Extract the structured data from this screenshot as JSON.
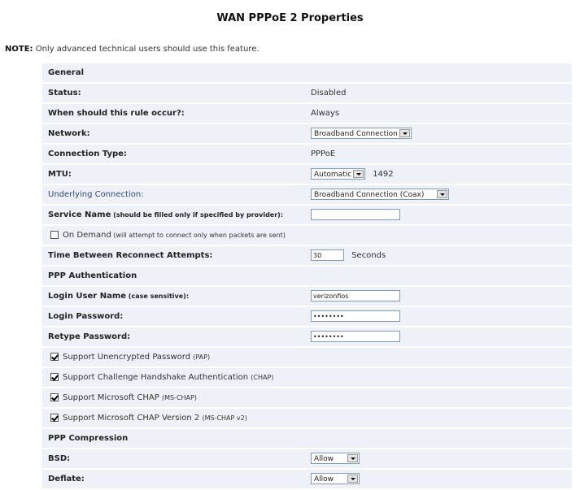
{
  "title": "WAN PPPoE 2 Properties",
  "note": {
    "prefix": "NOTE:",
    "text": " Only advanced technical users should use this feature."
  },
  "rows": {
    "general": "General",
    "status": {
      "label": "Status:",
      "value": "Disabled"
    },
    "when": {
      "label": "When should this rule occur?:",
      "value": "Always"
    },
    "network": {
      "label": "Network:",
      "value": "Broadband Connection"
    },
    "conn_type": {
      "label": "Connection Type:",
      "value": "PPPoE"
    },
    "mtu": {
      "label": "MTU:",
      "mode": "Automatic",
      "value": "1492"
    },
    "underlying": {
      "label": "Underlying Connection:",
      "value": "Broadband Connection (Coax)"
    },
    "service": {
      "label": "Service Name",
      "hint": " (should be filled only if specified by provider):",
      "value": ""
    },
    "on_demand": {
      "label": "On Demand",
      "hint": " (will attempt to connect only when packets are sent)",
      "checked": false
    },
    "reconnect": {
      "label": "Time Between Reconnect Attempts:",
      "value": "30",
      "unit": "Seconds"
    },
    "ppp_auth": "PPP Authentication",
    "login_user": {
      "label": "Login User Name",
      "hint": " (case sensitive):",
      "value": "verizonfios"
    },
    "login_pass": {
      "label": "Login Password:",
      "value": "••••••••"
    },
    "retype_pass": {
      "label": "Retype Password:",
      "value": "••••••••"
    },
    "pap": {
      "label": "Support Unencrypted Password ",
      "hint": "(PAP)",
      "checked": true
    },
    "chap": {
      "label": "Support Challenge Handshake Authentication ",
      "hint": "(CHAP)",
      "checked": true
    },
    "mschap": {
      "label": "Support Microsoft CHAP ",
      "hint": "(MS-CHAP)",
      "checked": true
    },
    "mschap2": {
      "label": "Support Microsoft CHAP Version 2 ",
      "hint": "(MS-CHAP v2)",
      "checked": true
    },
    "ppp_comp": "PPP Compression",
    "bsd": {
      "label": "BSD:",
      "value": "Allow"
    },
    "deflate": {
      "label": "Deflate:",
      "value": "Allow"
    }
  },
  "colors": {
    "row_bg": "#eef1f7",
    "link": "#334a8a",
    "field_border": "#7f9db9"
  }
}
